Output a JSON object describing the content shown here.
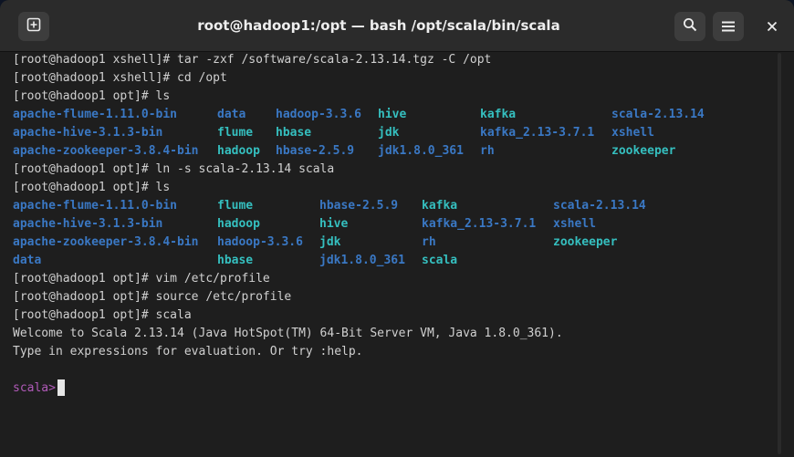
{
  "window": {
    "title": "root@hadoop1:/opt — bash /opt/scala/bin/scala"
  },
  "icons": {
    "new_tab": "new-tab-icon",
    "search": "search-icon",
    "menu": "hamburger-menu-icon",
    "close": "close-icon"
  },
  "colors": {
    "directory": "#3a78c4",
    "symlink": "#35bfbf",
    "scala_prompt": "#b05ab8",
    "text": "#d0d0d0",
    "background": "#1e1e1e"
  },
  "terminal": {
    "cmd1": "[root@hadoop1 xshell]# tar -zxf /software/scala-2.13.14.tgz -C /opt",
    "cmd2": "[root@hadoop1 xshell]# cd /opt",
    "cmd3": "[root@hadoop1 opt]# ls",
    "ls1": [
      [
        "apache-flume-1.11.0-bin",
        "data",
        "hadoop-3.3.6",
        "hive",
        "kafka",
        "scala-2.13.14"
      ],
      [
        "apache-hive-3.1.3-bin",
        "flume",
        "hbase",
        "jdk",
        "kafka_2.13-3.7.1",
        "xshell"
      ],
      [
        "apache-zookeeper-3.8.4-bin",
        "hadoop",
        "hbase-2.5.9",
        "jdk1.8.0_361",
        "rh",
        "zookeeper"
      ]
    ],
    "cmd4": "[root@hadoop1 opt]# ln -s scala-2.13.14 scala",
    "cmd5": "[root@hadoop1 opt]# ls",
    "ls2": [
      [
        "apache-flume-1.11.0-bin",
        "flume",
        "hbase-2.5.9",
        "kafka",
        "scala-2.13.14"
      ],
      [
        "apache-hive-3.1.3-bin",
        "hadoop",
        "hive",
        "kafka_2.13-3.7.1",
        "xshell"
      ],
      [
        "apache-zookeeper-3.8.4-bin",
        "hadoop-3.3.6",
        "jdk",
        "rh",
        "zookeeper"
      ],
      [
        "data",
        "hbase",
        "jdk1.8.0_361",
        "scala",
        ""
      ]
    ],
    "cmd6": "[root@hadoop1 opt]# vim /etc/profile",
    "cmd7": "[root@hadoop1 opt]# source /etc/profile",
    "cmd8": "[root@hadoop1 opt]# scala",
    "out1": "Welcome to Scala 2.13.14 (Java HotSpot(TM) 64-Bit Server VM, Java 1.8.0_361).",
    "out2": "Type in expressions for evaluation. Or try :help.",
    "scala_prompt": "scala>"
  }
}
